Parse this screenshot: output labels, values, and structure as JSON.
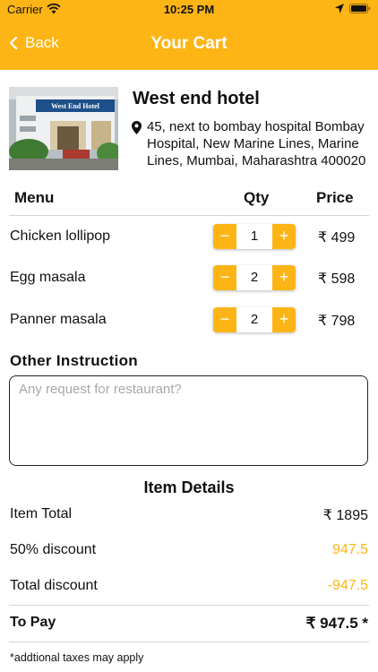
{
  "status_bar": {
    "carrier": "Carrier",
    "time": "10:25 PM"
  },
  "nav": {
    "back_label": "Back",
    "title": "Your Cart"
  },
  "restaurant": {
    "name": "West end hotel",
    "address": "45, next to bombay hospital Bombay Hospital, New Marine Lines, Marine Lines, Mumbai, Maharashtra 400020",
    "image_sign_text": "West End Hotel"
  },
  "table": {
    "menu_header": "Menu",
    "qty_header": "Qty",
    "price_header": "Price"
  },
  "items": [
    {
      "name": "Chicken lollipop",
      "qty": "1",
      "price": "₹ 499"
    },
    {
      "name": "Egg masala",
      "qty": "2",
      "price": "₹ 598"
    },
    {
      "name": "Panner masala",
      "qty": "2",
      "price": "₹ 798"
    }
  ],
  "stepper": {
    "minus": "−",
    "plus": "+"
  },
  "instruction": {
    "label": "Other Instruction",
    "placeholder": "Any request for restaurant?"
  },
  "details": {
    "title": "Item Details",
    "item_total_label": "Item Total",
    "item_total_value": "₹ 1895",
    "discount_label": "50% discount",
    "discount_value": "947.5",
    "total_discount_label": "Total discount",
    "total_discount_value": "-947.5",
    "to_pay_label": "To Pay",
    "to_pay_value": "₹ 947.5 *"
  },
  "note": "*addtional taxes may apply",
  "colors": {
    "accent": "#FDB515",
    "text": "#111111",
    "divider": "#d4d4d4"
  }
}
